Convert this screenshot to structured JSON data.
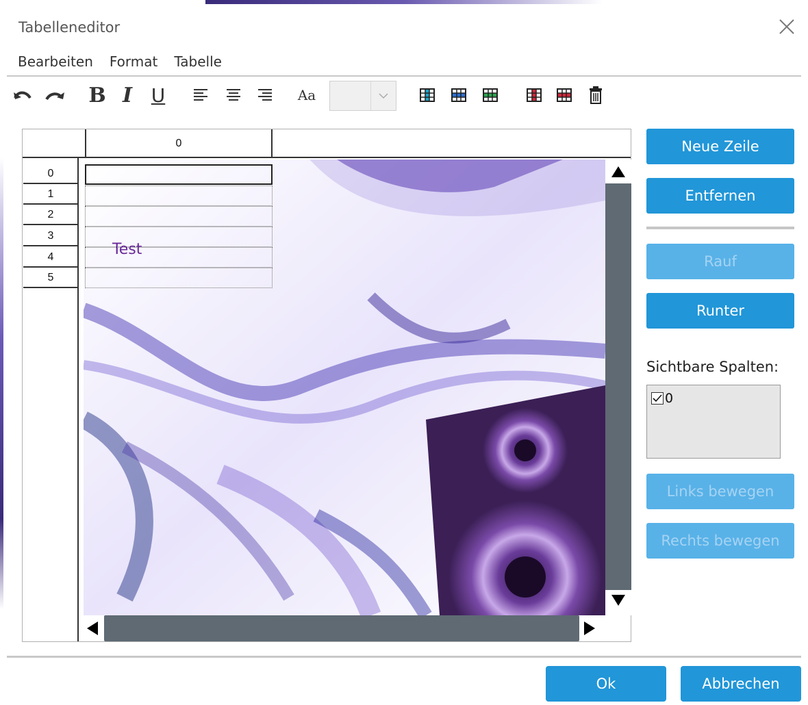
{
  "window": {
    "title": "Tabelleneditor"
  },
  "menu": {
    "items": [
      "Bearbeiten",
      "Format",
      "Tabelle"
    ]
  },
  "toolbar": {
    "icons": [
      "undo-icon",
      "redo-icon",
      "bold-icon",
      "italic-icon",
      "underline-icon",
      "align-left-icon",
      "align-center-icon",
      "align-right-icon",
      "font-size-icon",
      "insert-column-icon",
      "table-icon",
      "insert-row-icon",
      "delete-column-icon",
      "delete-row-icon",
      "trash-icon"
    ],
    "bold": "B",
    "italic": "I",
    "underline": "U",
    "font_size": "Aa",
    "font_select_value": "",
    "colors": {
      "cyan": "#1aa6c8",
      "blue": "#2c6fd0",
      "green": "#2ea44f",
      "red": "#d0283a"
    }
  },
  "table": {
    "column_headers": [
      "0"
    ],
    "row_headers": [
      "0",
      "1",
      "2",
      "3",
      "4",
      "5"
    ],
    "cells": [
      "",
      "",
      "",
      "",
      "Test",
      ""
    ],
    "selected_row": 0
  },
  "actions": {
    "new_row": "Neue Zeile",
    "remove": "Entfernen",
    "up": "Rauf",
    "down": "Runter",
    "visible_columns_label": "Sichtbare Spalten:",
    "visible_columns": [
      {
        "label": "0",
        "checked": true
      }
    ],
    "move_left": "Links bewegen",
    "move_right": "Rechts bewegen"
  },
  "footer": {
    "ok": "Ok",
    "cancel": "Abbrechen"
  },
  "colors": {
    "accent": "#2196d8",
    "accent_disabled": "#58b2e8",
    "scrollbar": "#5f6a73",
    "cell_text": "#6a2a9a"
  }
}
